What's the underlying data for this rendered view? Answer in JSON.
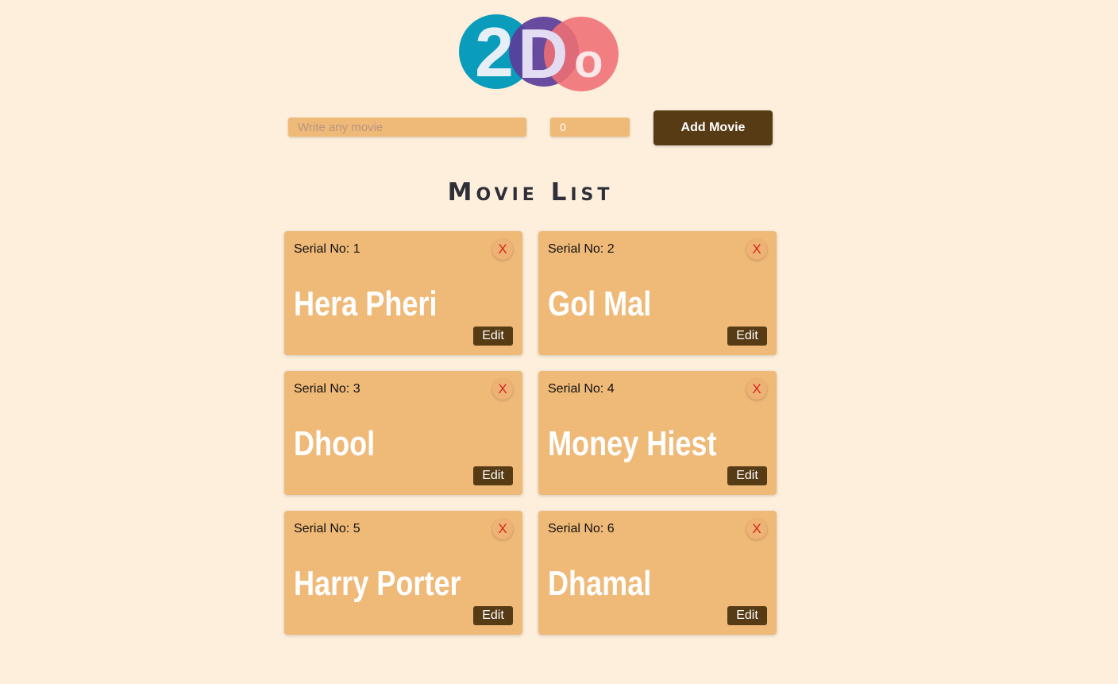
{
  "logo": {
    "text_2": "2",
    "text_D": "D",
    "text_o": "o",
    "colors": [
      "#0a9dbb",
      "#5b3d99",
      "#ef6e73"
    ]
  },
  "form": {
    "movie_placeholder": "Write any movie",
    "serial_value": "0",
    "add_label": "Add Movie"
  },
  "list": {
    "title": "Movie List"
  },
  "cards": [
    {
      "serial": "Serial No: 1",
      "name": "Hera Pheri",
      "close": "X",
      "edit": "Edit"
    },
    {
      "serial": "Serial No: 2",
      "name": "Gol Mal",
      "close": "X",
      "edit": "Edit"
    },
    {
      "serial": "Serial No: 3",
      "name": "Dhool",
      "close": "X",
      "edit": "Edit"
    },
    {
      "serial": "Serial No: 4",
      "name": "Money Hiest",
      "close": "X",
      "edit": "Edit"
    },
    {
      "serial": "Serial No: 5",
      "name": "Harry Porter",
      "close": "X",
      "edit": "Edit"
    },
    {
      "serial": "Serial No: 6",
      "name": "Dhamal",
      "close": "X",
      "edit": "Edit"
    }
  ]
}
